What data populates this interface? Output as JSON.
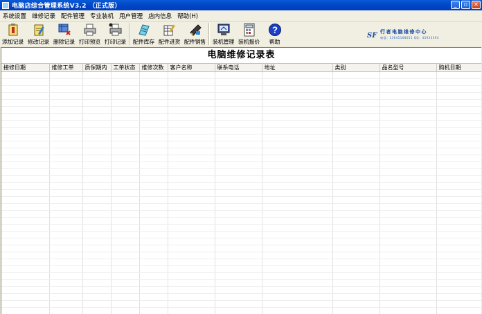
{
  "window": {
    "title": "电脑店综合管理系统V3.2 （正式版）",
    "buttons": {
      "minimize": "_",
      "restore": "▫",
      "close": "✕"
    }
  },
  "menu": [
    {
      "label": "系统设置"
    },
    {
      "label": "维修记录"
    },
    {
      "label": "配件管理"
    },
    {
      "label": "专业装机"
    },
    {
      "label": "用户管理"
    },
    {
      "label": "店内信息"
    },
    {
      "label": "帮助(H)"
    }
  ],
  "toolbar": [
    {
      "label": "添加记录",
      "icon": "add-record-icon"
    },
    {
      "label": "修改记录",
      "icon": "edit-record-icon"
    },
    {
      "label": "删除记录",
      "icon": "delete-record-icon"
    },
    {
      "label": "打印预览",
      "icon": "print-preview-icon"
    },
    {
      "label": "打印记录",
      "icon": "print-icon"
    },
    {
      "label": "配件库存",
      "icon": "parts-stock-icon"
    },
    {
      "label": "配件进货",
      "icon": "parts-purchase-icon"
    },
    {
      "label": "配件销售",
      "icon": "parts-sales-icon"
    },
    {
      "label": "装机管理",
      "icon": "assembly-manage-icon"
    },
    {
      "label": "装机报价",
      "icon": "assembly-quote-icon"
    },
    {
      "label": "帮助",
      "icon": "help-icon"
    }
  ],
  "logo": {
    "mark": "SF",
    "text": "行者电脑维修中心",
    "sub": "电话：13645168051  QQ：45923394"
  },
  "colors": {
    "titlebar": "#0048c8",
    "help_icon": "#1a3fc8"
  },
  "report": {
    "title": "电脑维修记录表",
    "columns": [
      "接修日期",
      "维修工单",
      "质保期内",
      "工单状态",
      "维修次数",
      "客户名称",
      "联系电话",
      "地址",
      "类别",
      "品名型号",
      "购机日期"
    ]
  }
}
